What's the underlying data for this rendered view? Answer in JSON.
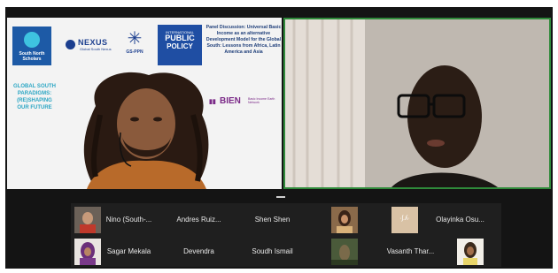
{
  "meeting": {
    "main_tiles": {
      "left": {
        "banner": {
          "south_north_scholars": "South North Scholars",
          "nexus_name": "NEXUS",
          "nexus_tagline": "Global South Nexus",
          "gsppn": "GS-PPN",
          "ipp_line1": "INTERNATIONAL",
          "ipp_line2": "PUBLIC",
          "ipp_line3": "POLICY",
          "panel_title": "Panel Discussion: Universal Basic Income as an alternative Development Model for the Global South: Lessons from Africa, Latin America and Asia",
          "bien_name": "BIEN",
          "bien_subtitle": "Basic Income Earth Network",
          "global_south_text": "GLOBAL SOUTH PARADIGMS: (RE)SHAPING OUR FUTURE"
        }
      }
    },
    "participants_row1": [
      {
        "name": "Nino (South-...",
        "video": true
      },
      {
        "name": "Andres Ruiz...",
        "video": false
      },
      {
        "name": "Shen Shen",
        "video": false
      },
      {
        "name": "",
        "video": true
      },
      {
        "name": "",
        "video": true,
        "badge": "·ʃ.ʎ·"
      },
      {
        "name": "Olayinka Osu...",
        "video": false
      }
    ],
    "participants_row2": [
      {
        "name": "Sagar Mekala",
        "video": true
      },
      {
        "name": "Devendra",
        "video": false
      },
      {
        "name": "Soudh Ismail",
        "video": false
      },
      {
        "name": "",
        "video": true
      },
      {
        "name": "Vasanth Thar...",
        "video": false
      },
      {
        "name": "",
        "video": true
      }
    ]
  },
  "colors": {
    "active_speaker_border": "#2f8a3a",
    "background": "#141414",
    "strip": "#1f1f1f"
  }
}
